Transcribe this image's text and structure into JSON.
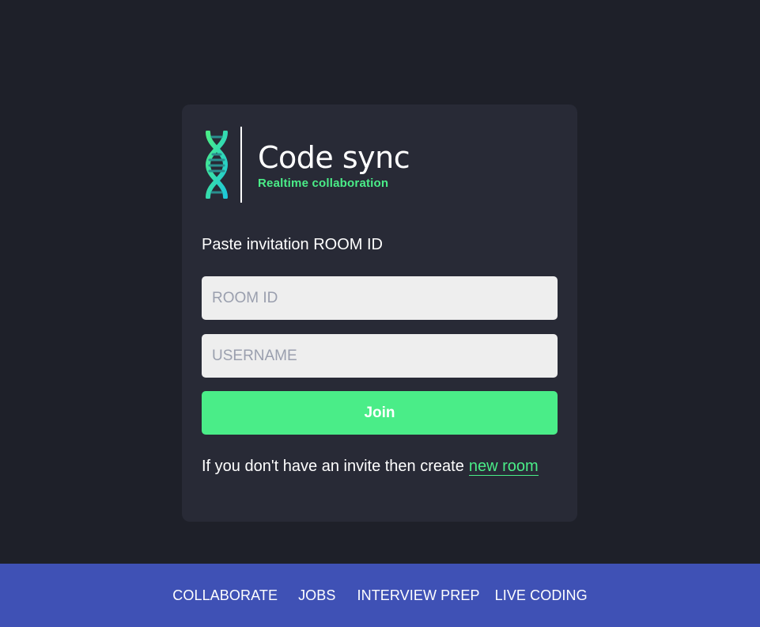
{
  "brand": {
    "title": "Code sync",
    "subtitle": "Realtime collaboration",
    "logo_icon": "dna-icon"
  },
  "join_form": {
    "invite_label": "Paste invitation ROOM ID",
    "room_id_placeholder": "ROOM ID",
    "username_placeholder": "USERNAME",
    "room_id_value": "",
    "username_value": "",
    "join_label": "Join",
    "create_text": "If you don't have an invite then create",
    "create_link": "new room"
  },
  "footer": {
    "links": [
      "COLLABORATE",
      "JOBS",
      "INTERVIEW PREP",
      "LIVE CODING"
    ]
  },
  "colors": {
    "page_background": "#1e2029",
    "card_background": "#282a36",
    "accent_green": "#4aed88",
    "input_background": "#eeeeee",
    "footer_background": "#3f51b5"
  }
}
